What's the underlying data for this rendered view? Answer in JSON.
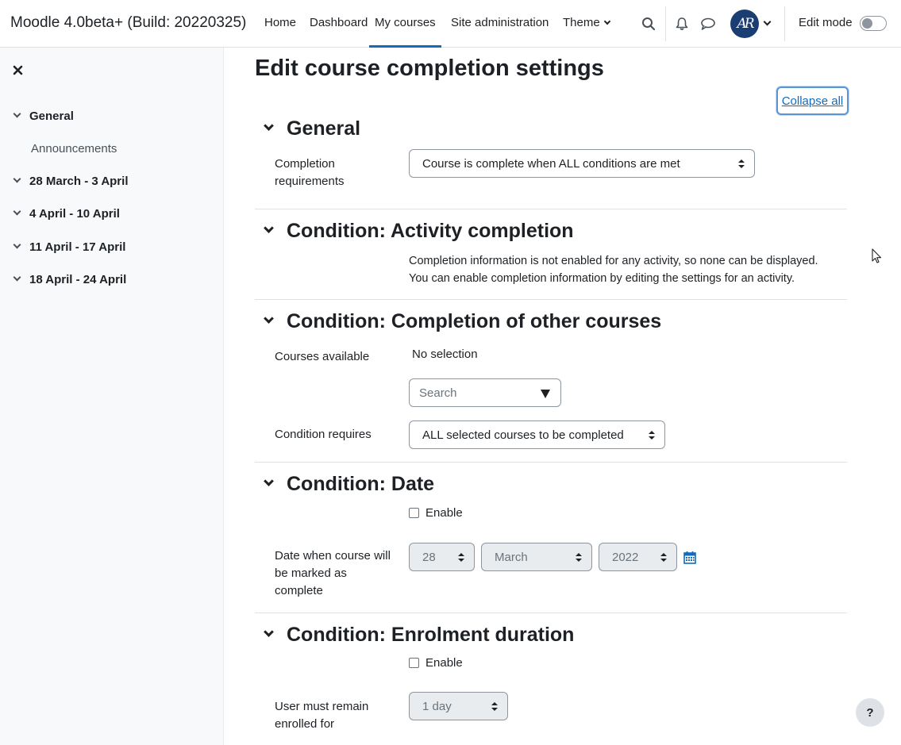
{
  "header": {
    "site_name": "Moodle 4.0beta+ (Build: 20220325)",
    "nav": [
      "Home",
      "Dashboard",
      "My courses",
      "Site administration",
      "Theme"
    ],
    "active_nav": "My courses",
    "avatar_initials": "AR",
    "edit_mode_label": "Edit mode",
    "edit_mode_on": false,
    "icons": [
      "search-icon",
      "bell-icon",
      "chat-icon"
    ]
  },
  "drawer": {
    "sections": [
      "General",
      "28 March - 3 April",
      "4 April - 10 April",
      "11 April - 17 April",
      "18 April - 24 April"
    ],
    "general_items": [
      "Announcements"
    ]
  },
  "main": {
    "title": "Edit course completion settings",
    "collapse_all": "Collapse all",
    "general": {
      "heading": "General",
      "requirements_label": "Completion requirements",
      "requirements_value": "Course is complete when ALL conditions are met"
    },
    "activity": {
      "heading": "Condition: Activity completion",
      "info_line1": "Completion information is not enabled for any activity, so none can be displayed.",
      "info_line2": "You can enable completion information by editing the settings for an activity."
    },
    "other_courses": {
      "heading": "Condition: Completion of other courses",
      "courses_available_label": "Courses available",
      "no_selection": "No selection",
      "search_placeholder": "Search",
      "condition_requires_label": "Condition requires",
      "condition_requires_value": "ALL selected courses to be completed"
    },
    "date": {
      "heading": "Condition: Date",
      "enable_label": "Enable",
      "enabled": false,
      "date_label": "Date when course will be marked as complete",
      "day": "28",
      "month": "March",
      "year": "2022"
    },
    "enrolment": {
      "heading": "Condition: Enrolment duration",
      "enable_label": "Enable",
      "enabled": false,
      "duration_label": "User must remain enrolled for",
      "duration_value": "1 day"
    }
  },
  "help_button": "?"
}
